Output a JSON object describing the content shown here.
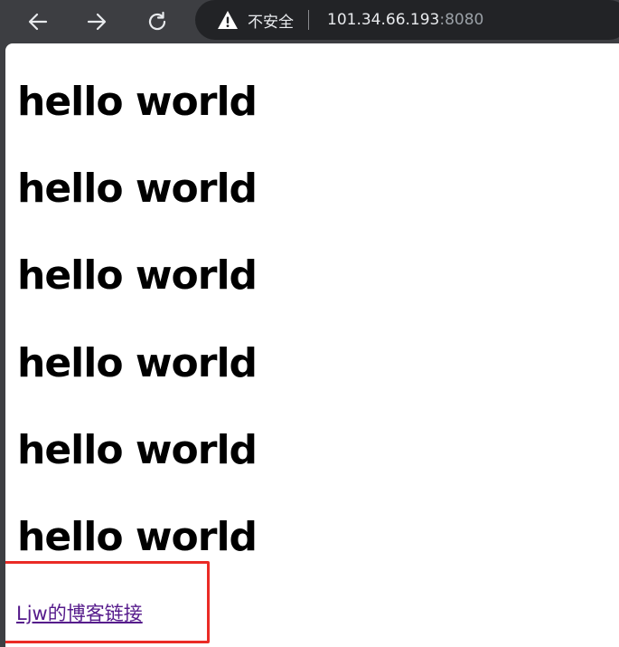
{
  "toolbar": {
    "back_icon": "arrow-left-icon",
    "forward_icon": "arrow-right-icon",
    "reload_icon": "reload-icon",
    "omnibox": {
      "security_icon": "warning-triangle-icon",
      "security_label": "不安全",
      "url_host": "101.34.66.193",
      "url_port": ":8080"
    }
  },
  "page": {
    "headings": [
      "hello world",
      "hello world",
      "hello world",
      "hello world",
      "hello world",
      "hello world"
    ],
    "link_text": "Ljw的博客链接",
    "link_color": "#551a8b"
  },
  "annotation": {
    "highlight_color": "#ea2b26"
  }
}
